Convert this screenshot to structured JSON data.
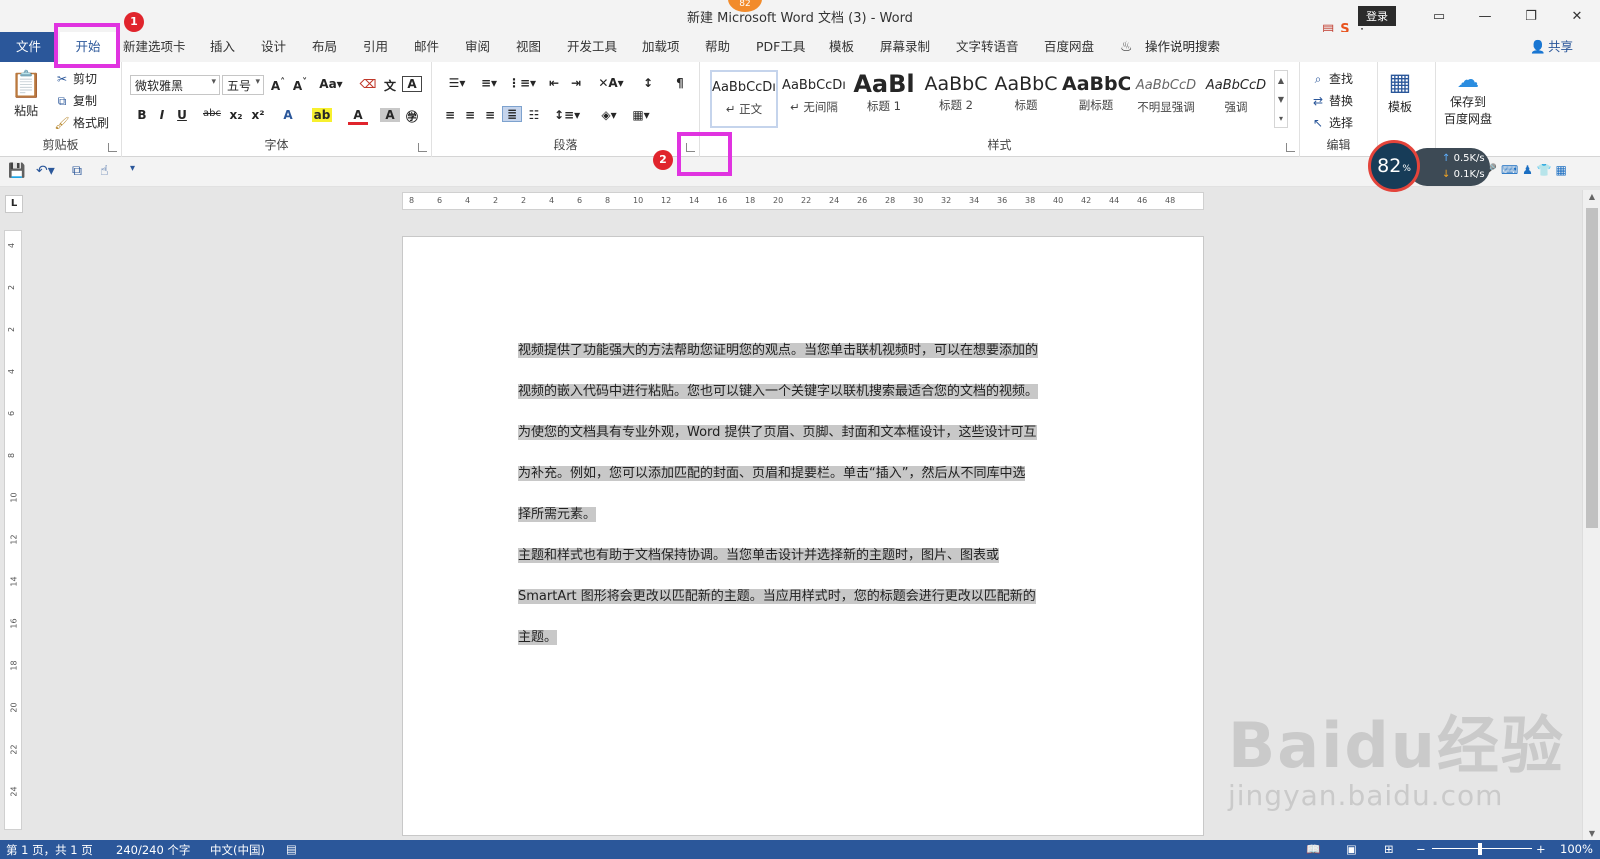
{
  "window": {
    "title": "新建 Microsoft Word 文档 (3)  -  Word",
    "login": "登录",
    "badge": "82"
  },
  "tabs": {
    "file": "文件",
    "items": [
      "开始",
      "新建选项卡",
      "插入",
      "设计",
      "布局",
      "引用",
      "邮件",
      "审阅",
      "视图",
      "开发工具",
      "加载项",
      "帮助",
      "PDF工具",
      "模板",
      "屏幕录制",
      "文字转语音",
      "百度网盘"
    ],
    "search_hint": "操作说明搜索",
    "share": "共享"
  },
  "ribbon": {
    "clipboard": {
      "paste": "粘贴",
      "cut": "剪切",
      "copy": "复制",
      "format_painter": "格式刷",
      "label": "剪贴板"
    },
    "font": {
      "name": "微软雅黑",
      "size": "五号",
      "label": "字体"
    },
    "paragraph": {
      "label": "段落"
    },
    "styles": {
      "label": "样式",
      "items": [
        {
          "sample": "AaBbCcDı",
          "name": "↵ 正文"
        },
        {
          "sample": "AaBbCcDı",
          "name": "↵ 无间隔"
        },
        {
          "sample": "AaBl",
          "name": "标题 1"
        },
        {
          "sample": "AaBbC",
          "name": "标题 2"
        },
        {
          "sample": "AaBbC",
          "name": "标题"
        },
        {
          "sample": "AaBbC",
          "name": "副标题"
        },
        {
          "sample": "AaBbCcD",
          "name": "不明显强调"
        },
        {
          "sample": "AaBbCcD",
          "name": "强调"
        }
      ]
    },
    "editing": {
      "find": "查找",
      "replace": "替换",
      "select": "选择",
      "label": "编辑"
    },
    "template": "模板",
    "baidu": {
      "line1": "保存到",
      "line2": "百度网盘"
    }
  },
  "ruler": {
    "h_ticks": [
      "8",
      "6",
      "4",
      "2",
      "2",
      "4",
      "6",
      "8",
      "10",
      "12",
      "14",
      "16",
      "18",
      "20",
      "22",
      "24",
      "26",
      "28",
      "30",
      "32",
      "34",
      "36",
      "38",
      "40",
      "42",
      "44",
      "46",
      "48"
    ],
    "v_ticks": [
      "4",
      "2",
      "2",
      "4",
      "6",
      "8",
      "10",
      "12",
      "14",
      "16",
      "18",
      "20",
      "22",
      "24"
    ]
  },
  "document": {
    "lines": [
      "视频提供了功能强大的方法帮助您证明您的观点。当您单击联机视频时，可以在想要添加的",
      "视频的嵌入代码中进行粘贴。您也可以键入一个关键字以联机搜索最适合您的文档的视频。",
      "为使您的文档具有专业外观，Word 提供了页眉、页脚、封面和文本框设计，这些设计可互",
      "为补充。例如，您可以添加匹配的封面、页眉和提要栏。单击“插入”，然后从不同库中选",
      "择所需元素。",
      "主题和样式也有助于文档保持协调。当您单击设计并选择新的主题时，图片、图表或",
      "SmartArt 图形将会更改以匹配新的主题。当应用样式时，您的标题会进行更改以匹配新的",
      "主题。"
    ]
  },
  "status": {
    "page": "第 1 页，共 1 页",
    "words": "240/240 个字",
    "language": "中文(中国)",
    "zoom": "100%"
  },
  "annotations": {
    "step1": "1",
    "step2": "2"
  },
  "net_widget": {
    "percent": "82",
    "unit": "%",
    "up": "0.5K/s",
    "down": "0.1K/s"
  },
  "watermark": {
    "brand": "Baidu经验",
    "url": "jingyan.baidu.com"
  }
}
